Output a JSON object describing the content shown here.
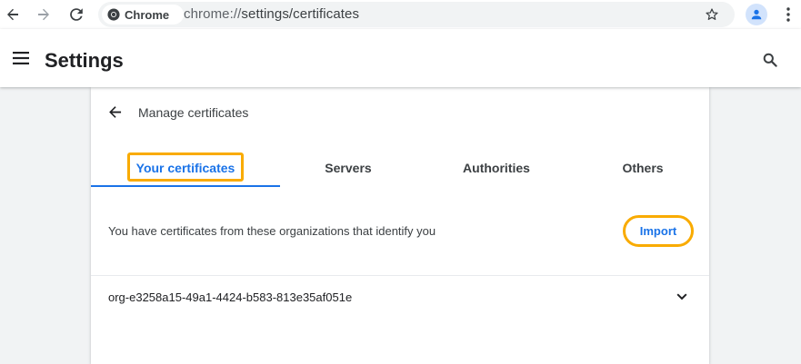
{
  "browser": {
    "chip_label": "Chrome",
    "url_scheme": "chrome://",
    "url_path": "settings/certificates"
  },
  "header": {
    "title": "Settings"
  },
  "subpage": {
    "title": "Manage certificates",
    "tabs": [
      {
        "label": "Your certificates",
        "active": true
      },
      {
        "label": "Servers",
        "active": false
      },
      {
        "label": "Authorities",
        "active": false
      },
      {
        "label": "Others",
        "active": false
      }
    ],
    "description": "You have certificates from these organizations that identify you",
    "import_label": "Import",
    "certificates": [
      {
        "name": "org-e3258a15-49a1-4424-b583-813e35af051e"
      }
    ]
  },
  "colors": {
    "accent": "#1a73e8",
    "focus_ring": "#f9ab00",
    "text": "#3c4043"
  },
  "icons": {
    "back": "arrow-left-icon",
    "forward": "arrow-right-icon",
    "reload": "reload-icon",
    "star": "star-icon",
    "profile": "person-icon",
    "menu": "kebab-menu-icon",
    "hamburger": "hamburger-menu-icon",
    "search": "search-icon",
    "expand": "chevron-down-icon"
  }
}
